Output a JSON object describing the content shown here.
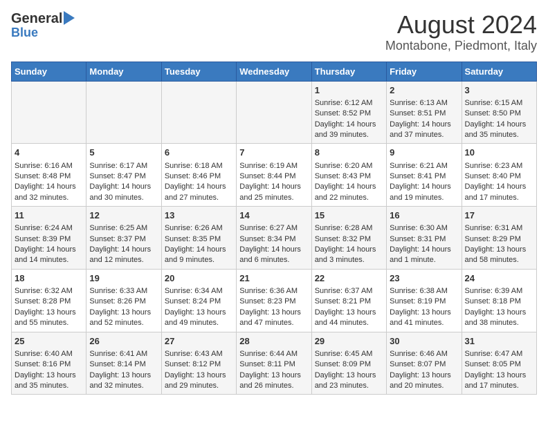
{
  "header": {
    "logo_line1": "General",
    "logo_line2": "Blue",
    "title": "August 2024",
    "subtitle": "Montabone, Piedmont, Italy"
  },
  "days_of_week": [
    "Sunday",
    "Monday",
    "Tuesday",
    "Wednesday",
    "Thursday",
    "Friday",
    "Saturday"
  ],
  "weeks": [
    [
      {
        "day": "",
        "content": ""
      },
      {
        "day": "",
        "content": ""
      },
      {
        "day": "",
        "content": ""
      },
      {
        "day": "",
        "content": ""
      },
      {
        "day": "1",
        "content": "Sunrise: 6:12 AM\nSunset: 8:52 PM\nDaylight: 14 hours\nand 39 minutes."
      },
      {
        "day": "2",
        "content": "Sunrise: 6:13 AM\nSunset: 8:51 PM\nDaylight: 14 hours\nand 37 minutes."
      },
      {
        "day": "3",
        "content": "Sunrise: 6:15 AM\nSunset: 8:50 PM\nDaylight: 14 hours\nand 35 minutes."
      }
    ],
    [
      {
        "day": "4",
        "content": "Sunrise: 6:16 AM\nSunset: 8:48 PM\nDaylight: 14 hours\nand 32 minutes."
      },
      {
        "day": "5",
        "content": "Sunrise: 6:17 AM\nSunset: 8:47 PM\nDaylight: 14 hours\nand 30 minutes."
      },
      {
        "day": "6",
        "content": "Sunrise: 6:18 AM\nSunset: 8:46 PM\nDaylight: 14 hours\nand 27 minutes."
      },
      {
        "day": "7",
        "content": "Sunrise: 6:19 AM\nSunset: 8:44 PM\nDaylight: 14 hours\nand 25 minutes."
      },
      {
        "day": "8",
        "content": "Sunrise: 6:20 AM\nSunset: 8:43 PM\nDaylight: 14 hours\nand 22 minutes."
      },
      {
        "day": "9",
        "content": "Sunrise: 6:21 AM\nSunset: 8:41 PM\nDaylight: 14 hours\nand 19 minutes."
      },
      {
        "day": "10",
        "content": "Sunrise: 6:23 AM\nSunset: 8:40 PM\nDaylight: 14 hours\nand 17 minutes."
      }
    ],
    [
      {
        "day": "11",
        "content": "Sunrise: 6:24 AM\nSunset: 8:39 PM\nDaylight: 14 hours\nand 14 minutes."
      },
      {
        "day": "12",
        "content": "Sunrise: 6:25 AM\nSunset: 8:37 PM\nDaylight: 14 hours\nand 12 minutes."
      },
      {
        "day": "13",
        "content": "Sunrise: 6:26 AM\nSunset: 8:35 PM\nDaylight: 14 hours\nand 9 minutes."
      },
      {
        "day": "14",
        "content": "Sunrise: 6:27 AM\nSunset: 8:34 PM\nDaylight: 14 hours\nand 6 minutes."
      },
      {
        "day": "15",
        "content": "Sunrise: 6:28 AM\nSunset: 8:32 PM\nDaylight: 14 hours\nand 3 minutes."
      },
      {
        "day": "16",
        "content": "Sunrise: 6:30 AM\nSunset: 8:31 PM\nDaylight: 14 hours\nand 1 minute."
      },
      {
        "day": "17",
        "content": "Sunrise: 6:31 AM\nSunset: 8:29 PM\nDaylight: 13 hours\nand 58 minutes."
      }
    ],
    [
      {
        "day": "18",
        "content": "Sunrise: 6:32 AM\nSunset: 8:28 PM\nDaylight: 13 hours\nand 55 minutes."
      },
      {
        "day": "19",
        "content": "Sunrise: 6:33 AM\nSunset: 8:26 PM\nDaylight: 13 hours\nand 52 minutes."
      },
      {
        "day": "20",
        "content": "Sunrise: 6:34 AM\nSunset: 8:24 PM\nDaylight: 13 hours\nand 49 minutes."
      },
      {
        "day": "21",
        "content": "Sunrise: 6:36 AM\nSunset: 8:23 PM\nDaylight: 13 hours\nand 47 minutes."
      },
      {
        "day": "22",
        "content": "Sunrise: 6:37 AM\nSunset: 8:21 PM\nDaylight: 13 hours\nand 44 minutes."
      },
      {
        "day": "23",
        "content": "Sunrise: 6:38 AM\nSunset: 8:19 PM\nDaylight: 13 hours\nand 41 minutes."
      },
      {
        "day": "24",
        "content": "Sunrise: 6:39 AM\nSunset: 8:18 PM\nDaylight: 13 hours\nand 38 minutes."
      }
    ],
    [
      {
        "day": "25",
        "content": "Sunrise: 6:40 AM\nSunset: 8:16 PM\nDaylight: 13 hours\nand 35 minutes."
      },
      {
        "day": "26",
        "content": "Sunrise: 6:41 AM\nSunset: 8:14 PM\nDaylight: 13 hours\nand 32 minutes."
      },
      {
        "day": "27",
        "content": "Sunrise: 6:43 AM\nSunset: 8:12 PM\nDaylight: 13 hours\nand 29 minutes."
      },
      {
        "day": "28",
        "content": "Sunrise: 6:44 AM\nSunset: 8:11 PM\nDaylight: 13 hours\nand 26 minutes."
      },
      {
        "day": "29",
        "content": "Sunrise: 6:45 AM\nSunset: 8:09 PM\nDaylight: 13 hours\nand 23 minutes."
      },
      {
        "day": "30",
        "content": "Sunrise: 6:46 AM\nSunset: 8:07 PM\nDaylight: 13 hours\nand 20 minutes."
      },
      {
        "day": "31",
        "content": "Sunrise: 6:47 AM\nSunset: 8:05 PM\nDaylight: 13 hours\nand 17 minutes."
      }
    ]
  ]
}
